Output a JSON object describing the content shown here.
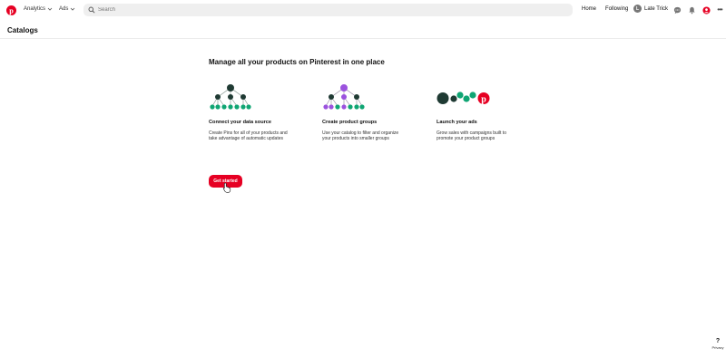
{
  "topbar": {
    "logo_icon": "pinterest-logo-icon",
    "analytics_label": "Analytics",
    "ads_label": "Ads",
    "search_placeholder": "Search",
    "home_label": "Home",
    "following_label": "Following",
    "user_name": "Late Trick",
    "user_initial": "L"
  },
  "page": {
    "title": "Catalogs",
    "headline": "Manage all your products on Pinterest in one place"
  },
  "cards": [
    {
      "title": "Connect your data source",
      "desc": "Create Pins for all of your products and take advantage of automatic updates",
      "illustration": "green-tree-icon"
    },
    {
      "title": "Create product groups",
      "desc": "Use your catalog to filter and organize your products into smaller groups",
      "illustration": "purple-tree-icon"
    },
    {
      "title": "Launch your ads",
      "desc": "Grow sales with campaigns built to promote your product groups",
      "illustration": "dots-pinterest-icon"
    }
  ],
  "cta": {
    "label": "Get started"
  },
  "help": {
    "q": "?",
    "privacy": "Privacy"
  },
  "colors": {
    "brand": "#e60023",
    "green": "#0fa573",
    "dark": "#1f3a33",
    "purple": "#9b52de"
  }
}
